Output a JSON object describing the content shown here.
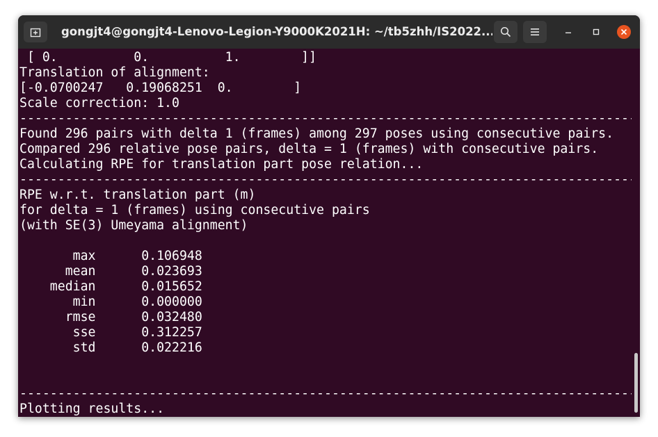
{
  "window": {
    "title": "gongjt4@gongjt4-Lenovo-Legion-Y9000K2021H: ~/tb5zhh/IS2022..."
  },
  "titlebar_icons": {
    "new_tab": "new-tab-icon",
    "search": "search-icon",
    "menu": "hamburger-menu-icon",
    "minimize": "minimize-icon",
    "maximize": "maximize-icon",
    "close": "close-icon"
  },
  "colors": {
    "terminal_bg": "#300a24",
    "titlebar_bg": "#2b2b2b",
    "close_accent": "#e95420",
    "text": "#ffffff"
  },
  "terminal": {
    "lines": [
      " [ 0.          0.          1.        ]]",
      "Translation of alignment:",
      "[-0.0700247   0.19068251  0.        ]",
      "Scale correction: 1.0",
      "-----------------------------------------------------------------------------------",
      "Found 296 pairs with delta 1 (frames) among 297 poses using consecutive pairs.",
      "Compared 296 relative pose pairs, delta = 1 (frames) with consecutive pairs.",
      "Calculating RPE for translation part pose relation...",
      "-----------------------------------------------------------------------------------",
      "RPE w.r.t. translation part (m)",
      "for delta = 1 (frames) using consecutive pairs",
      "(with SE(3) Umeyama alignment)",
      "",
      "       max\t0.106948",
      "      mean\t0.023693",
      "    median\t0.015652",
      "       min\t0.000000",
      "      rmse\t0.032480",
      "       sse\t0.312257",
      "       std\t0.022216",
      "",
      "",
      "-----------------------------------------------------------------------------------",
      "Plotting results..."
    ]
  }
}
